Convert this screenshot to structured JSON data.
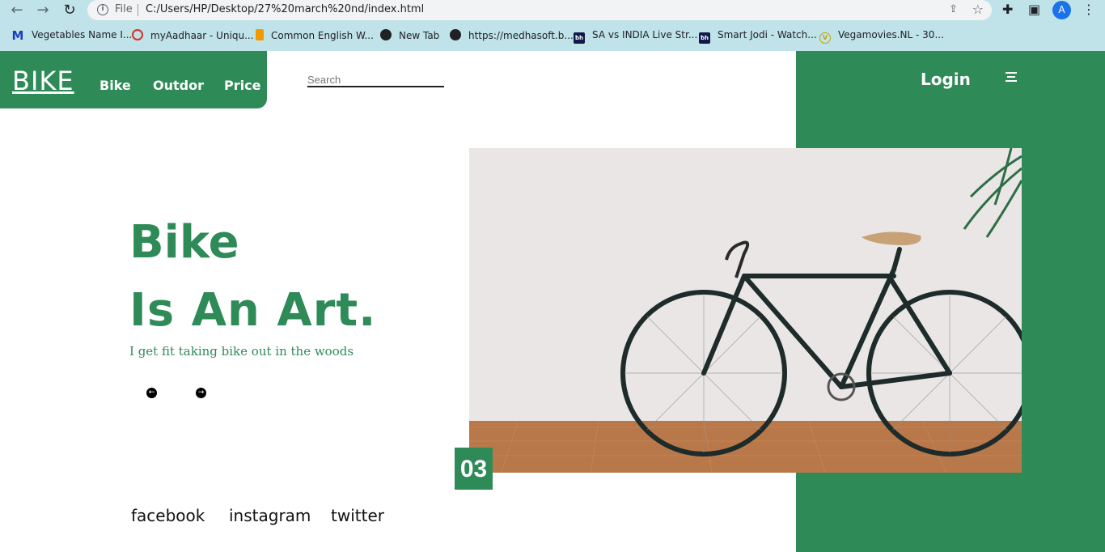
{
  "browser": {
    "url_scheme": "File",
    "url": "C:/Users/HP/Desktop/27%20march%20nd/index.html",
    "profile_initial": "A",
    "bookmarks": [
      {
        "label": "Vegetables Name I...",
        "icon": "M"
      },
      {
        "label": "myAadhaar - Uniqu...",
        "icon": "aadhaar"
      },
      {
        "label": "Common English W...",
        "icon": "doc"
      },
      {
        "label": "New Tab",
        "icon": "globe"
      },
      {
        "label": "https://medhasoft.b...",
        "icon": "globe"
      },
      {
        "label": "SA vs INDIA Live Str...",
        "icon": "bh"
      },
      {
        "label": "Smart Jodi - Watch...",
        "icon": "bh"
      },
      {
        "label": "Vegamovies.NL - 30...",
        "icon": "v"
      }
    ]
  },
  "header": {
    "logo": "BIKE",
    "nav": [
      "Bike",
      "Outdor",
      "Price"
    ],
    "search_placeholder": "Search",
    "login": "Login"
  },
  "hero": {
    "title_line1": "Bike",
    "title_line2": "Is An Art.",
    "tagline": "I get fit taking bike out in the woods",
    "counter": "03"
  },
  "social": [
    "facebook",
    "instagram",
    "twitter"
  ],
  "colors": {
    "accent": "#2e8b57",
    "browser_bar": "#bfe3e8"
  }
}
